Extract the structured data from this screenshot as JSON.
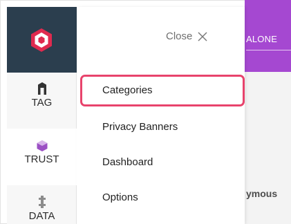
{
  "background": {
    "topbar_text": "ALONE",
    "partial_text": "ymous"
  },
  "rail": {
    "items": [
      {
        "label": "TAG",
        "icon": "tag-icon"
      },
      {
        "label": "TRUST",
        "icon": "trust-icon"
      },
      {
        "label": "DATA",
        "icon": "data-icon"
      }
    ]
  },
  "drawer": {
    "close_label": "Close",
    "menu": [
      {
        "label": "Categories"
      },
      {
        "label": "Privacy Banners"
      },
      {
        "label": "Dashboard"
      },
      {
        "label": "Options"
      }
    ]
  },
  "colors": {
    "logo_bg": "#2b3e4e",
    "accent_purple": "#a548d1",
    "highlight": "#e8436c"
  }
}
